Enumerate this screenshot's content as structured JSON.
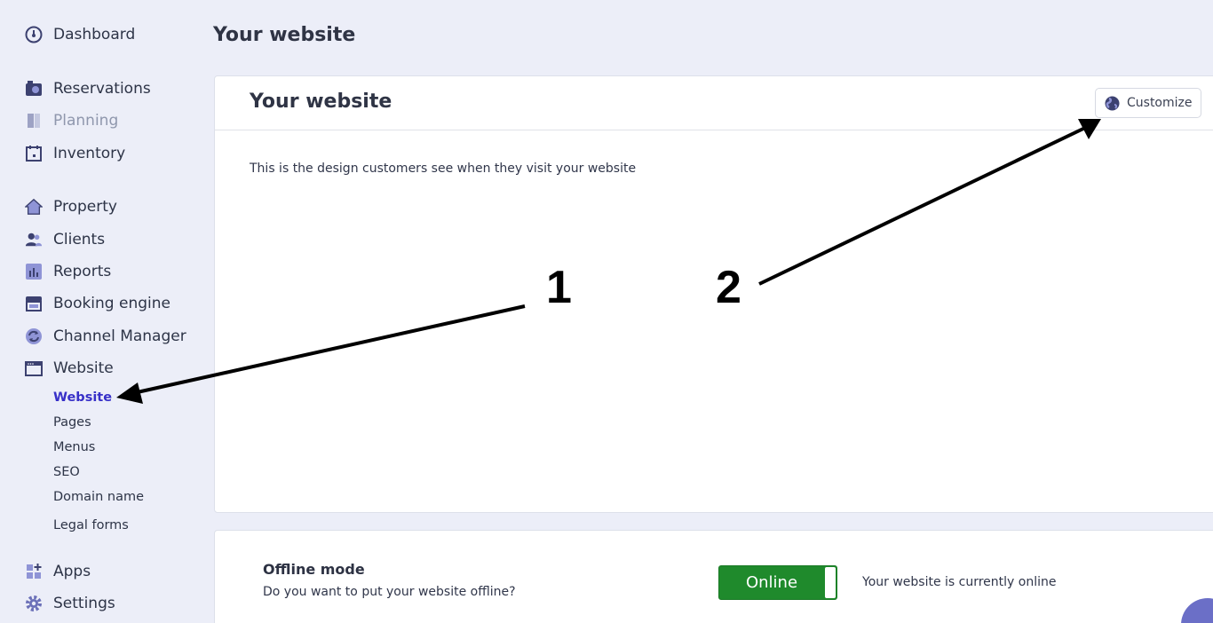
{
  "sidebar": {
    "items": [
      {
        "label": "Dashboard",
        "icon": "dashboard-icon"
      },
      {
        "label": "Reservations",
        "icon": "reservations-icon"
      },
      {
        "label": "Planning",
        "icon": "planning-icon"
      },
      {
        "label": "Inventory",
        "icon": "calendar-icon"
      },
      {
        "label": "Property",
        "icon": "home-icon"
      },
      {
        "label": "Clients",
        "icon": "clients-icon"
      },
      {
        "label": "Reports",
        "icon": "reports-icon"
      },
      {
        "label": "Booking engine",
        "icon": "store-icon"
      },
      {
        "label": "Channel Manager",
        "icon": "sync-icon"
      },
      {
        "label": "Website",
        "icon": "browser-window-icon"
      }
    ],
    "website_sub": [
      "Website",
      "Pages",
      "Menus",
      "SEO",
      "Domain name",
      "Legal forms"
    ],
    "bottom": [
      {
        "label": "Apps",
        "icon": "apps-icon"
      },
      {
        "label": "Settings",
        "icon": "gear-icon"
      }
    ]
  },
  "page": {
    "title": "Your website"
  },
  "website_card": {
    "title": "Your website",
    "customize_label": "Customize",
    "description": "This is the design customers see when they visit your website"
  },
  "offline_card": {
    "title": "Offline mode",
    "question": "Do you want to put your website offline?",
    "toggle_label": "Online",
    "status": "Your website is currently online"
  },
  "annotations": {
    "one": "1",
    "two": "2"
  },
  "colors": {
    "accent": "#3730c8",
    "online_green": "#1f8a2c",
    "background": "#eceef8",
    "icon": "#6b70b8"
  }
}
